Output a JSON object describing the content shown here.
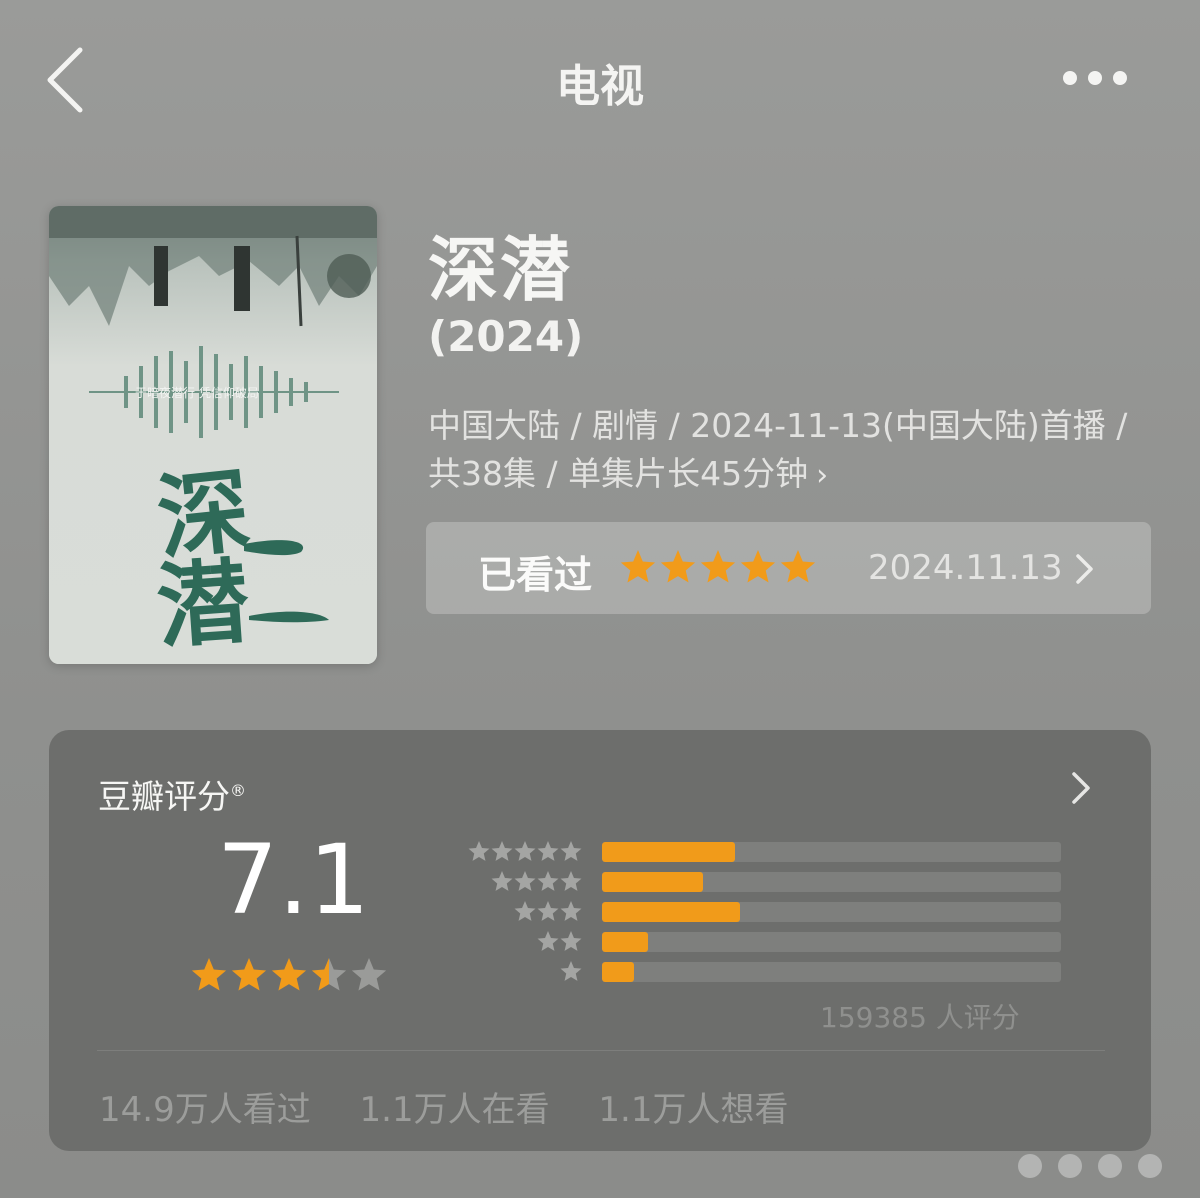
{
  "header": {
    "title": "电视",
    "back_icon": "chevron-left-icon",
    "more_icon": "more-dots-icon"
  },
  "poster": {
    "tagline": "于暗夜潜行 凭信仰破局",
    "title": "深潜"
  },
  "show": {
    "title": "深潜",
    "year": "(2024)",
    "meta": "中国大陆 / 剧情 / 2024-11-13(中国大陆)首播 / 共38集 / 单集片长45分钟",
    "meta_chevron": "›"
  },
  "watched": {
    "label": "已看过",
    "my_rating_stars": 5,
    "date": "2024.11.13",
    "star_color": "#f19b1a"
  },
  "rating": {
    "title": "豆瓣评分",
    "title_mark": "®",
    "score": "7.1",
    "score_stars": 3.5,
    "distribution": [
      {
        "stars": 5,
        "fraction": 0.29
      },
      {
        "stars": 4,
        "fraction": 0.22
      },
      {
        "stars": 3,
        "fraction": 0.3
      },
      {
        "stars": 2,
        "fraction": 0.1
      },
      {
        "stars": 1,
        "fraction": 0.07
      }
    ],
    "count_text": "159385 人评分",
    "bar_color": "#f19b1a"
  },
  "stats": {
    "watched": "14.9万人看过",
    "watching": "1.1万人在看",
    "want": "1.1万人想看"
  }
}
